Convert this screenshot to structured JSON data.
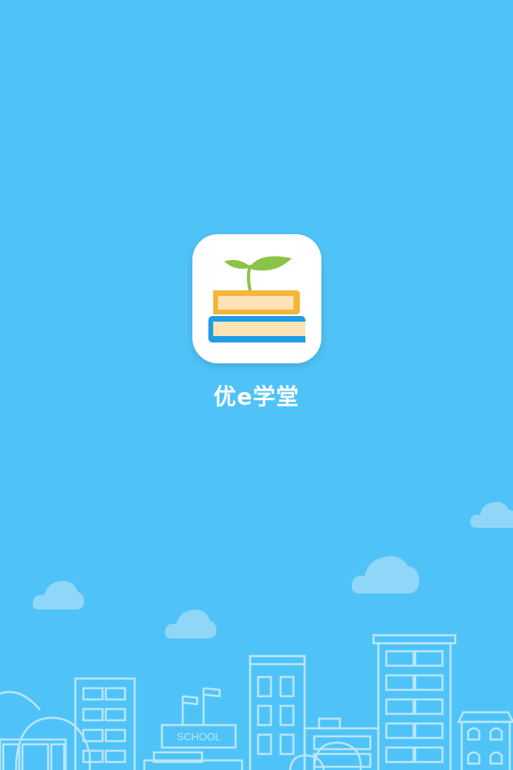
{
  "app": {
    "name": "优e学堂",
    "icon": "sprout-on-books-icon"
  },
  "background": {
    "sky_color": "#4fc3f7",
    "cloud_color": "#8fd6f9",
    "line_color": "#b9e6fb"
  },
  "illustration": {
    "school_sign": "SCHOOL"
  }
}
